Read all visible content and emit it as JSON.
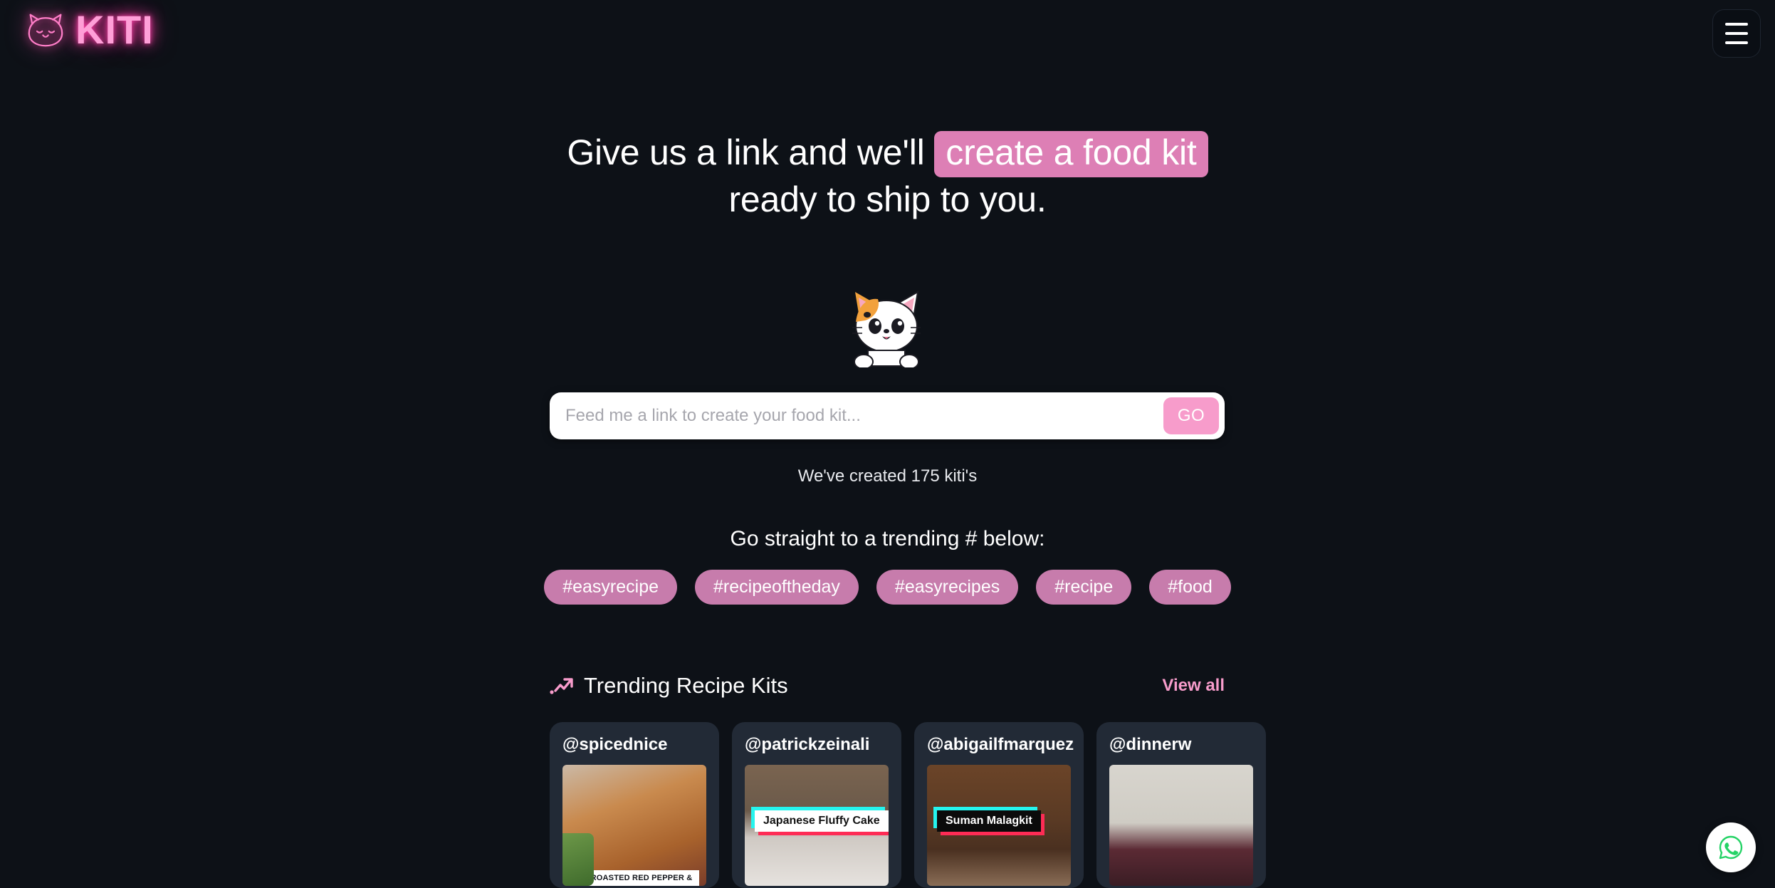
{
  "brand": {
    "name": "KITI",
    "logo_icon": "cat-face-icon",
    "accent": "#ff3fa8",
    "pink": "#f79ccb",
    "background": "#0d1117"
  },
  "header": {
    "menu_icon": "hamburger-menu-icon"
  },
  "hero": {
    "line1_prefix": "Give us a link and we'll",
    "highlight": "create a food kit",
    "line2": "ready to ship to you.",
    "highlight_color": "#dd7fb5"
  },
  "mascot": {
    "icon": "cat-mascot-icon"
  },
  "search": {
    "placeholder": "Feed me a link to create your food kit...",
    "value": "",
    "go_label": "GO"
  },
  "stats": {
    "created_text": "We've created 175 kiti's",
    "count": 175
  },
  "hashtags": {
    "title": "Go straight to a trending # below:",
    "items": [
      {
        "label": "#easyrecipe"
      },
      {
        "label": "#recipeoftheday"
      },
      {
        "label": "#easyrecipes"
      },
      {
        "label": "#recipe"
      },
      {
        "label": "#food"
      }
    ]
  },
  "trending": {
    "icon": "trending-up-icon",
    "title": "Trending Recipe Kits",
    "view_all_label": "View all",
    "cards": [
      {
        "handle": "@spicednice",
        "caption": "ROASTED RED PEPPER &",
        "badge": "tiktok-icon",
        "overlay": ""
      },
      {
        "handle": "@patrickzeinali",
        "caption": "",
        "badge": "tiktok-icon",
        "overlay": "Japanese Fluffy Cake"
      },
      {
        "handle": "@abigailfmarquez",
        "caption": "",
        "badge": "tiktok-icon",
        "overlay": "Suman Malagkit"
      },
      {
        "handle": "@dinnerw",
        "caption": "",
        "badge": "tiktok-icon",
        "overlay": ""
      }
    ]
  },
  "whatsapp": {
    "icon": "whatsapp-icon",
    "color": "#25D366"
  }
}
